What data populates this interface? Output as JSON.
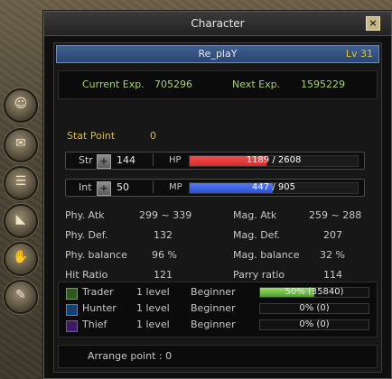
{
  "window": {
    "title": "Character",
    "close_label": "×"
  },
  "character": {
    "name": "Re_plaY",
    "level": "Lv 31"
  },
  "experience": {
    "current_label": "Current Exp.",
    "current_value": "705296",
    "next_label": "Next Exp.",
    "next_value": "1595229"
  },
  "stat_point": {
    "label": "Stat Point",
    "value": "0"
  },
  "str": {
    "label": "Str",
    "value": "144",
    "bar_label": "HP",
    "bar_text": "1189 / 2608",
    "fill": 0.456,
    "color": "#d42a2a"
  },
  "int": {
    "label": "Int",
    "value": "50",
    "bar_label": "MP",
    "bar_text": "447 / 905",
    "fill": 0.494,
    "color": "#2a4fd4"
  },
  "stats": {
    "phy_atk": {
      "label": "Phy. Atk",
      "value": "299 ~ 339"
    },
    "mag_atk": {
      "label": "Mag. Atk",
      "value": "259 ~ 288"
    },
    "phy_def": {
      "label": "Phy. Def.",
      "value": "132"
    },
    "mag_def": {
      "label": "Mag. Def.",
      "value": "207"
    },
    "phy_bal": {
      "label": "Phy. balance",
      "value": "96 %"
    },
    "mag_bal": {
      "label": "Mag. balance",
      "value": "32 %"
    },
    "hit": {
      "label": "Hit Ratio",
      "value": "121"
    },
    "parry": {
      "label": "Parry ratio",
      "value": "114"
    }
  },
  "jobs": [
    {
      "name": "Trader",
      "level": "1 level",
      "rank": "Beginner",
      "progress_text": "50% (35840)",
      "progress": 0.5,
      "icon": "trader-icon",
      "color": "#6aa83a"
    },
    {
      "name": "Hunter",
      "level": "1 level",
      "rank": "Beginner",
      "progress_text": "0% (0)",
      "progress": 0,
      "icon": "hunter-icon",
      "color": "#3a8ad8"
    },
    {
      "name": "Thief",
      "level": "1 level",
      "rank": "Beginner",
      "progress_text": "0% (0)",
      "progress": 0,
      "icon": "thief-icon",
      "color": "#8a4ad0"
    }
  ],
  "arrange": {
    "label": "Arrange point : 0"
  },
  "side_buttons": [
    "character-portrait-icon",
    "inventory-bag-icon",
    "skill-book-icon",
    "boots-icon",
    "handshake-icon",
    "scroll-icon"
  ]
}
